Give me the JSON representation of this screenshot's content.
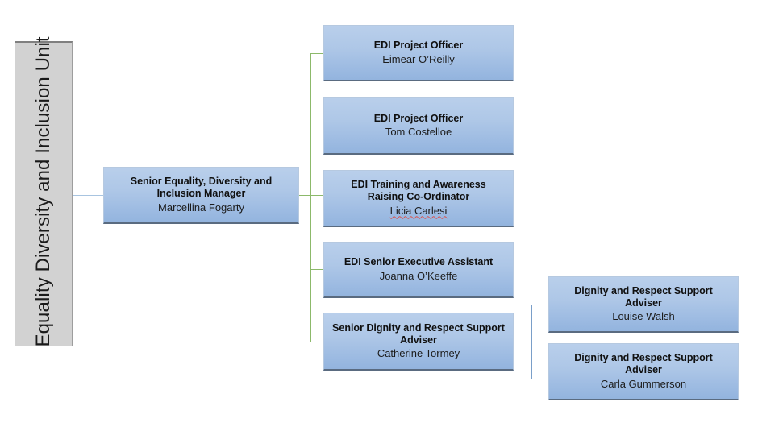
{
  "unit": {
    "label": "Equality Diversity and Inclusion Unit",
    "fill_color": "#d2d2d2",
    "border_color": "#9d9d9d"
  },
  "node_style": {
    "fill_top_color": "#b9cfeb",
    "fill_bottom_color": "#93b4de",
    "border_color": "#b6c9e0",
    "shadow_color": "#5a6b80"
  },
  "connectors": {
    "unit_to_manager_color": "#a8c4e0",
    "manager_branch_color": "#8cb96a",
    "adviser_branch_color": "#7a9fc9"
  },
  "manager": {
    "title": "Senior Equality, Diversity and Inclusion Manager",
    "person": "Marcellina Fogarty"
  },
  "reports": [
    {
      "title": "EDI Project Officer",
      "person": "Eimear O’Reilly",
      "misspelled": false
    },
    {
      "title": "EDI Project Officer",
      "person": "Tom Costelloe",
      "misspelled": false
    },
    {
      "title": "EDI Training and Awareness Raising Co-Ordinator",
      "person": "Licia Carlesi",
      "misspelled": true
    },
    {
      "title": "EDI Senior Executive Assistant",
      "person": "Joanna O’Keeffe",
      "misspelled": false
    },
    {
      "title": "Senior Dignity and Respect Support Adviser",
      "person": "Catherine Tormey",
      "misspelled": false
    }
  ],
  "sub_reports": [
    {
      "title": "Dignity and Respect Support Adviser",
      "person": "Louise Walsh",
      "misspelled": false
    },
    {
      "title": "Dignity and Respect Support Adviser",
      "person": "Carla Gummerson",
      "misspelled": false
    }
  ]
}
